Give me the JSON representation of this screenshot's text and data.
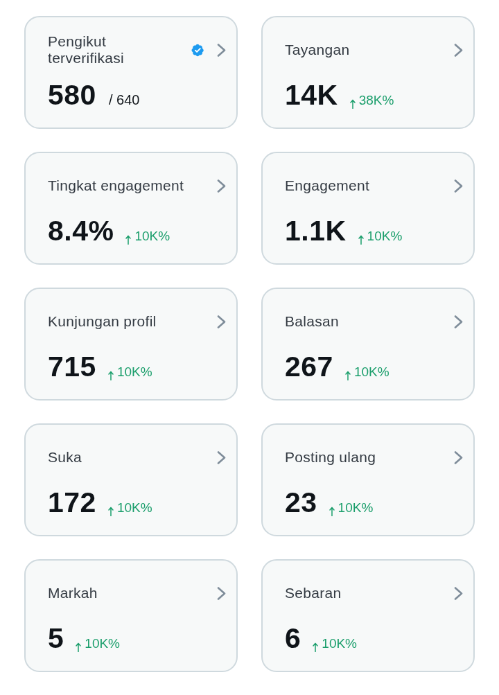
{
  "cards": [
    {
      "title": "Pengikut terverifikasi",
      "verified": true,
      "value": "580",
      "total": "/ 640"
    },
    {
      "title": "Tayangan",
      "verified": false,
      "value": "14K",
      "rising": true,
      "change": "38K%"
    },
    {
      "title": "Tingkat engagement",
      "verified": false,
      "value": "8.4%",
      "rising": true,
      "change": "10K%"
    },
    {
      "title": "Engagement",
      "verified": false,
      "value": "1.1K",
      "rising": true,
      "change": "10K%"
    },
    {
      "title": "Kunjungan profil",
      "verified": false,
      "value": "715",
      "rising": true,
      "change": "10K%"
    },
    {
      "title": "Balasan",
      "verified": false,
      "value": "267",
      "rising": true,
      "change": "10K%"
    },
    {
      "title": "Suka",
      "verified": false,
      "value": "172",
      "rising": true,
      "change": "10K%"
    },
    {
      "title": "Posting ulang",
      "verified": false,
      "value": "23",
      "rising": true,
      "change": "10K%"
    },
    {
      "title": "Markah",
      "verified": false,
      "value": "5",
      "rising": true,
      "change": "10K%"
    },
    {
      "title": "Sebaran",
      "verified": false,
      "value": "6",
      "rising": true,
      "change": "10K%"
    }
  ]
}
